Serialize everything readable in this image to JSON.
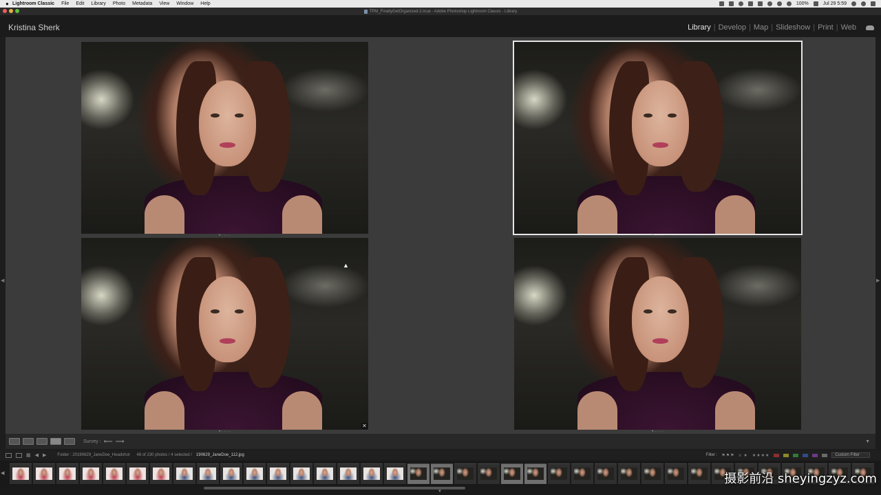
{
  "menubar": {
    "app_name": "Lightroom Classic",
    "items": [
      "File",
      "Edit",
      "Library",
      "Photo",
      "Metadata",
      "View",
      "Window",
      "Help"
    ],
    "battery": "100%",
    "clock": "Jul 29  5:59"
  },
  "window": {
    "title": "TPM_FinallyGetOrganized-2.lrcat - Adobe Photoshop Lightroom Classic - Library"
  },
  "identity_plate": "Kristina Sherk",
  "modules": [
    "Library",
    "Develop",
    "Map",
    "Slideshow",
    "Print",
    "Web"
  ],
  "active_module": "Library",
  "survey": {
    "photos": [
      {
        "id": 1,
        "selected": false
      },
      {
        "id": 2,
        "selected": true
      },
      {
        "id": 3,
        "selected": false
      },
      {
        "id": 4,
        "selected": false
      }
    ],
    "dots": "• · · · ·"
  },
  "toolbar": {
    "mode_label": "Survey :",
    "prev_arrow": "⟵",
    "next_arrow": "⟶"
  },
  "filmstrip_header": {
    "source": "Folder : 20190629_JaneDoe_Headshot",
    "count": "48 of 230 photos / 4 selected /",
    "selected_file": "190629_JaneDoe_112.jpg",
    "filter_label": "Filter :",
    "star_filter": "≥ ★",
    "custom_filter": "Custom Filter",
    "label_colors": [
      "#8b2f2f",
      "#8c8a2a",
      "#2f7a36",
      "#2e4b8a",
      "#6a3a84",
      "#6a6a6a"
    ]
  },
  "filmstrip": {
    "thumbs": [
      {
        "style": "red",
        "selected": false
      },
      {
        "style": "red",
        "selected": false
      },
      {
        "style": "red",
        "selected": false
      },
      {
        "style": "red",
        "selected": false
      },
      {
        "style": "red",
        "selected": false
      },
      {
        "style": "red",
        "selected": false
      },
      {
        "style": "red",
        "selected": false
      },
      {
        "style": "blue",
        "selected": false
      },
      {
        "style": "blue",
        "selected": false
      },
      {
        "style": "blue",
        "selected": false
      },
      {
        "style": "blue",
        "selected": false
      },
      {
        "style": "blue",
        "selected": false
      },
      {
        "style": "blue",
        "selected": false
      },
      {
        "style": "blue",
        "selected": false
      },
      {
        "style": "blue",
        "selected": false
      },
      {
        "style": "blue",
        "selected": false
      },
      {
        "style": "blue",
        "selected": false
      },
      {
        "style": "dark",
        "selected": true
      },
      {
        "style": "dark",
        "selected": true
      },
      {
        "style": "dark",
        "selected": false
      },
      {
        "style": "dark",
        "selected": false
      },
      {
        "style": "dark",
        "selected": true
      },
      {
        "style": "dark",
        "selected": true
      },
      {
        "style": "dark",
        "selected": false
      },
      {
        "style": "dark",
        "selected": false
      },
      {
        "style": "dark",
        "selected": false
      },
      {
        "style": "dark",
        "selected": false
      },
      {
        "style": "dark",
        "selected": false
      },
      {
        "style": "dark",
        "selected": false
      },
      {
        "style": "dark",
        "selected": false
      },
      {
        "style": "dark",
        "selected": false
      },
      {
        "style": "dark",
        "selected": false
      },
      {
        "style": "dark",
        "selected": false
      },
      {
        "style": "dark",
        "selected": false
      },
      {
        "style": "dark",
        "selected": false
      },
      {
        "style": "dark",
        "selected": false
      },
      {
        "style": "dark",
        "selected": false
      }
    ]
  },
  "watermark": "摄影前沿 sheyingzyz.com"
}
